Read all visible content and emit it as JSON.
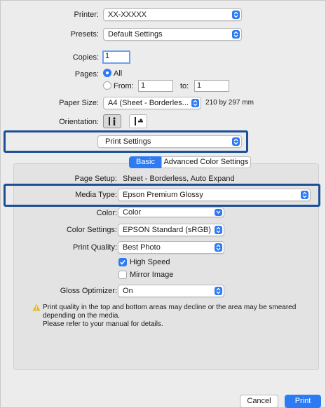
{
  "printer": {
    "label": "Printer:",
    "value": "XX-XXXXX"
  },
  "presets": {
    "label": "Presets:",
    "value": "Default Settings"
  },
  "copies": {
    "label": "Copies:",
    "value": "1"
  },
  "pages": {
    "label": "Pages:",
    "all_label": "All",
    "from_label": "From:",
    "from_value": "1",
    "to_label": "to:",
    "to_value": "1",
    "selected": "All"
  },
  "paper_size": {
    "label": "Paper Size:",
    "value": "A4 (Sheet - Borderles...",
    "dimensions": "210 by 297 mm"
  },
  "orientation": {
    "label": "Orientation:",
    "selected": "portrait"
  },
  "section_popup": {
    "value": "Print Settings"
  },
  "tabs": [
    {
      "label": "Basic",
      "active": true
    },
    {
      "label": "Advanced Color Settings",
      "active": false
    }
  ],
  "settings": {
    "page_setup": {
      "label": "Page Setup:",
      "value": "Sheet - Borderless, Auto Expand"
    },
    "media_type": {
      "label": "Media Type:",
      "value": "Epson Premium Glossy"
    },
    "color": {
      "label": "Color:",
      "value": "Color"
    },
    "color_settings": {
      "label": "Color Settings:",
      "value": "EPSON Standard (sRGB)"
    },
    "print_quality": {
      "label": "Print Quality:",
      "value": "Best Photo"
    },
    "high_speed": {
      "label": "High Speed",
      "checked": true
    },
    "mirror_image": {
      "label": "Mirror Image",
      "checked": false
    },
    "gloss_optimizer": {
      "label": "Gloss Optimizer:",
      "value": "On"
    }
  },
  "warning": {
    "line1": "Print quality in the top and bottom areas may decline or the area may be smeared",
    "line2": "depending on the media.",
    "line3": "Please refer to your manual for details."
  },
  "buttons": {
    "cancel": "Cancel",
    "print": "Print"
  },
  "colors": {
    "accent": "#2d7bf4",
    "highlight_border": "#1d4f96",
    "warning": "#e8b923"
  }
}
